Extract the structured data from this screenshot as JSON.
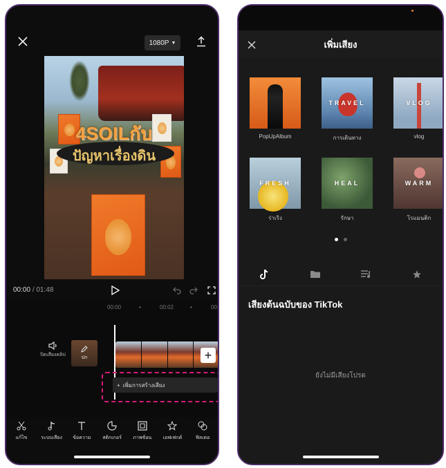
{
  "left": {
    "resolution": "1080P",
    "video": {
      "title_line1": "4SOILกับ",
      "title_line2": "ปัญหาเรื่องดิน"
    },
    "transport": {
      "current_time": "00:00",
      "total_time": "01:48"
    },
    "ruler": [
      "00:00",
      "00:02",
      "00:0"
    ],
    "audio_label": "ปิดเสียงคลิป",
    "cover_label": "ปก",
    "voiceover_label": "เพิ่มการสร้างเสียง",
    "tools": [
      {
        "icon": "scissors-icon",
        "label": "แก้ไข"
      },
      {
        "icon": "music-note-icon",
        "label": "ระบบเสียง"
      },
      {
        "icon": "text-icon",
        "label": "ข้อความ"
      },
      {
        "icon": "sticker-icon",
        "label": "สติกเกอร์"
      },
      {
        "icon": "picture-in-picture-icon",
        "label": "ภาพซ้อน"
      },
      {
        "icon": "effects-icon",
        "label": "เอฟเฟกต์"
      },
      {
        "icon": "filter-icon",
        "label": "ฟิลเตอ"
      }
    ],
    "accent_colors": {
      "highlight_dashed": "#d81b7a",
      "phone_border": "#4a2c66"
    }
  },
  "right": {
    "title": "เพิ่มเสียง",
    "albums": [
      {
        "caption": "PopUpAlbum",
        "art_text": "",
        "style": "art-pop"
      },
      {
        "caption": "การเดินทาง",
        "art_text": "TRAVEL",
        "style": "art-travel"
      },
      {
        "caption": "vlog",
        "art_text": "VLOG",
        "style": "art-vlog"
      },
      {
        "caption": "ร่าเริง",
        "art_text": "FRESH",
        "style": "art-fresh"
      },
      {
        "caption": "รักษา",
        "art_text": "HEAL",
        "style": "art-heal"
      },
      {
        "caption": "โรแมนติก",
        "art_text": "WARM",
        "style": "art-warm"
      }
    ],
    "pager": {
      "pages": 2,
      "active": 0
    },
    "tabs": [
      "tiktok-icon",
      "folder-icon",
      "playlist-icon",
      "star-icon"
    ],
    "section_title": "เสียงต้นฉบับของ TikTok",
    "empty_state": "ยังไม่มีเสียงโปรด"
  }
}
